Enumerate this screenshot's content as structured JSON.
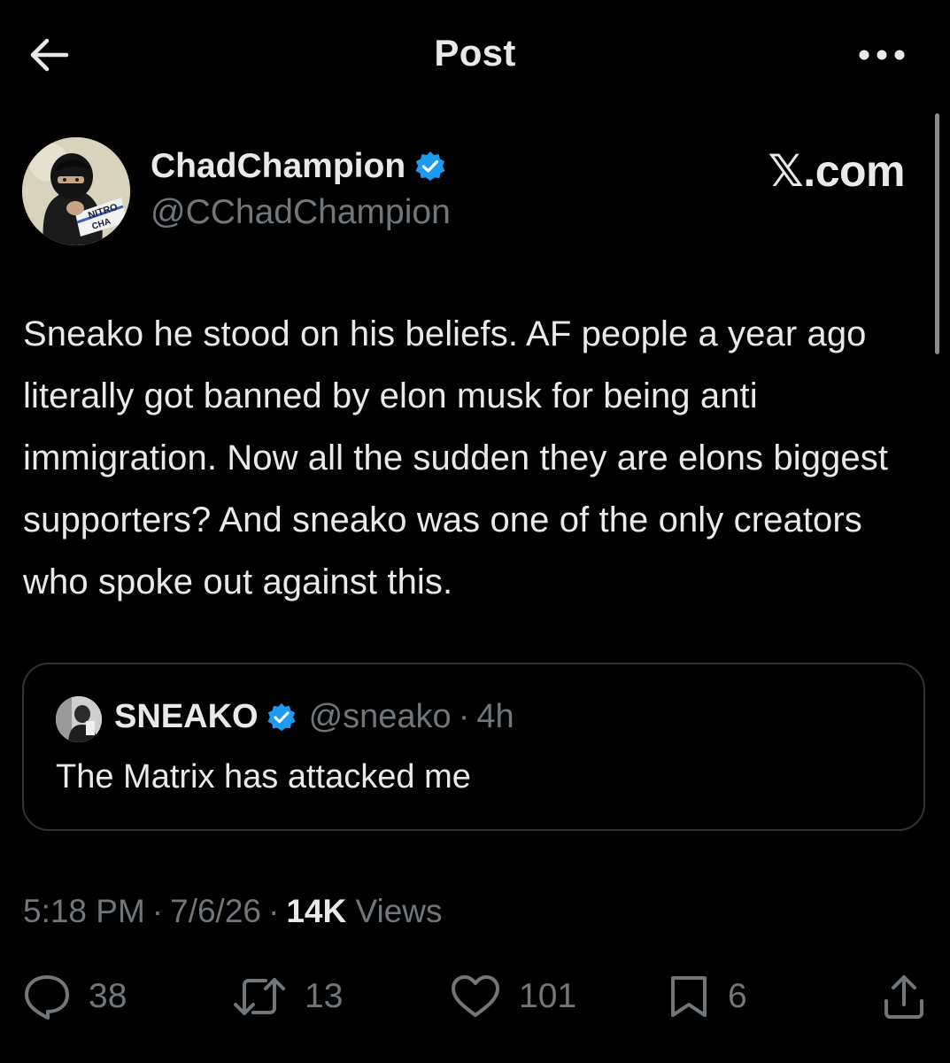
{
  "header": {
    "title": "Post",
    "back_icon": "arrow-left-icon",
    "more_icon": "more-horizontal-icon"
  },
  "post": {
    "author": {
      "name": "ChadChampion",
      "handle": "@CChadChampion",
      "verified_icon": "verified-badge-icon",
      "verified_color": "#1d9bf0"
    },
    "brand": "𝕏.com",
    "text": "Sneako he stood on his beliefs. AF people a year ago literally got banned by elon musk for being anti immigration. Now all the sudden they are elons biggest supporters? And sneako was one of the only creators who spoke out against this.",
    "quote": {
      "name": "SNEAKO",
      "handle": "@sneako",
      "dot": "·",
      "time": "4h",
      "text": "The Matrix has attacked me"
    },
    "meta": {
      "time": "5:18 PM",
      "sep1": "·",
      "date": "7/6/26",
      "sep2": "·",
      "views_count": "14K",
      "views_label": "Views"
    },
    "actions": {
      "replies": "38",
      "reposts": "13",
      "likes": "101",
      "bookmarks": "6"
    }
  },
  "colors": {
    "background": "#000000",
    "text_primary": "#e7e9ea",
    "text_secondary": "#71767b",
    "border": "#2f3336",
    "accent": "#1d9bf0"
  }
}
